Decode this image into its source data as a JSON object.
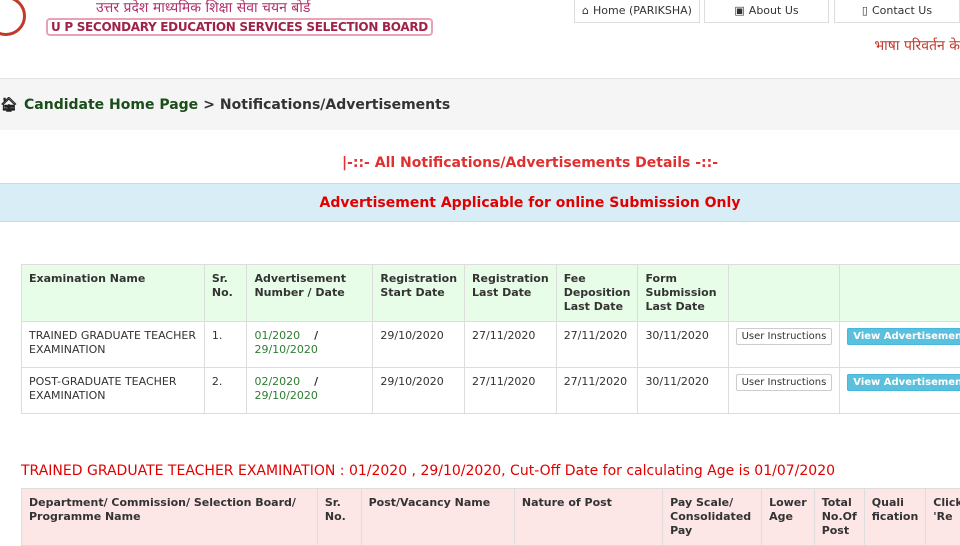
{
  "header": {
    "hindi_title": "उत्तर प्रदेश माध्यमिक शिक्षा सेवा चयन बोर्ड",
    "english_title": "U P SECONDARY EDUCATION SERVICES SELECTION BOARD",
    "nav": [
      {
        "label": "Home (PARIKSHA)",
        "icon": "home-icon"
      },
      {
        "label": "About Us",
        "icon": "contact-card-icon"
      },
      {
        "label": "Contact Us",
        "icon": "phone-icon"
      }
    ],
    "language_link": "भाषा परिवर्तन के"
  },
  "breadcrumb": {
    "home": "Candidate Home Page",
    "sep": ">",
    "current": "Notifications/Advertisements"
  },
  "page_title": "|-::- All Notifications/Advertisements Details -::-",
  "band_text": "Advertisement Applicable for online Submission Only",
  "table": {
    "headers": [
      "Examination Name",
      "Sr. No.",
      "Advertisement Number / Date",
      "Registration Start Date",
      "Registration Last Date",
      "Fee Deposition Last Date",
      "Form Submission Last Date",
      "",
      ""
    ],
    "rows": [
      {
        "name": "TRAINED GRADUATE TEACHER EXAMINATION",
        "sr": "1.",
        "adv_no": "01/2020",
        "adv_date": "29/10/2020",
        "reg_start": "29/10/2020",
        "reg_last": "27/11/2020",
        "fee_last": "27/11/2020",
        "form_last": "30/11/2020",
        "btn1": "User Instructions",
        "btn2": "View Advertisement"
      },
      {
        "name": "POST-GRADUATE TEACHER EXAMINATION",
        "sr": "2.",
        "adv_no": "02/2020",
        "adv_date": "29/10/2020",
        "reg_start": "29/10/2020",
        "reg_last": "27/11/2020",
        "fee_last": "27/11/2020",
        "form_last": "30/11/2020",
        "btn1": "User Instructions",
        "btn2": "View Advertisement"
      }
    ]
  },
  "section_title": "TRAINED GRADUATE TEACHER EXAMINATION : 01/2020 , 29/10/2020, Cut-Off Date for calculating Age is 01/07/2020",
  "table2": {
    "headers": [
      "Department/ Commission/ Selection Board/ Programme Name",
      "Sr. No.",
      "Post/Vacancy Name",
      "Nature of Post",
      "Pay Scale/ Consolidated Pay",
      "Lower Age",
      "Total No.Of Post",
      "Quali fication",
      "Click 'Re"
    ]
  }
}
